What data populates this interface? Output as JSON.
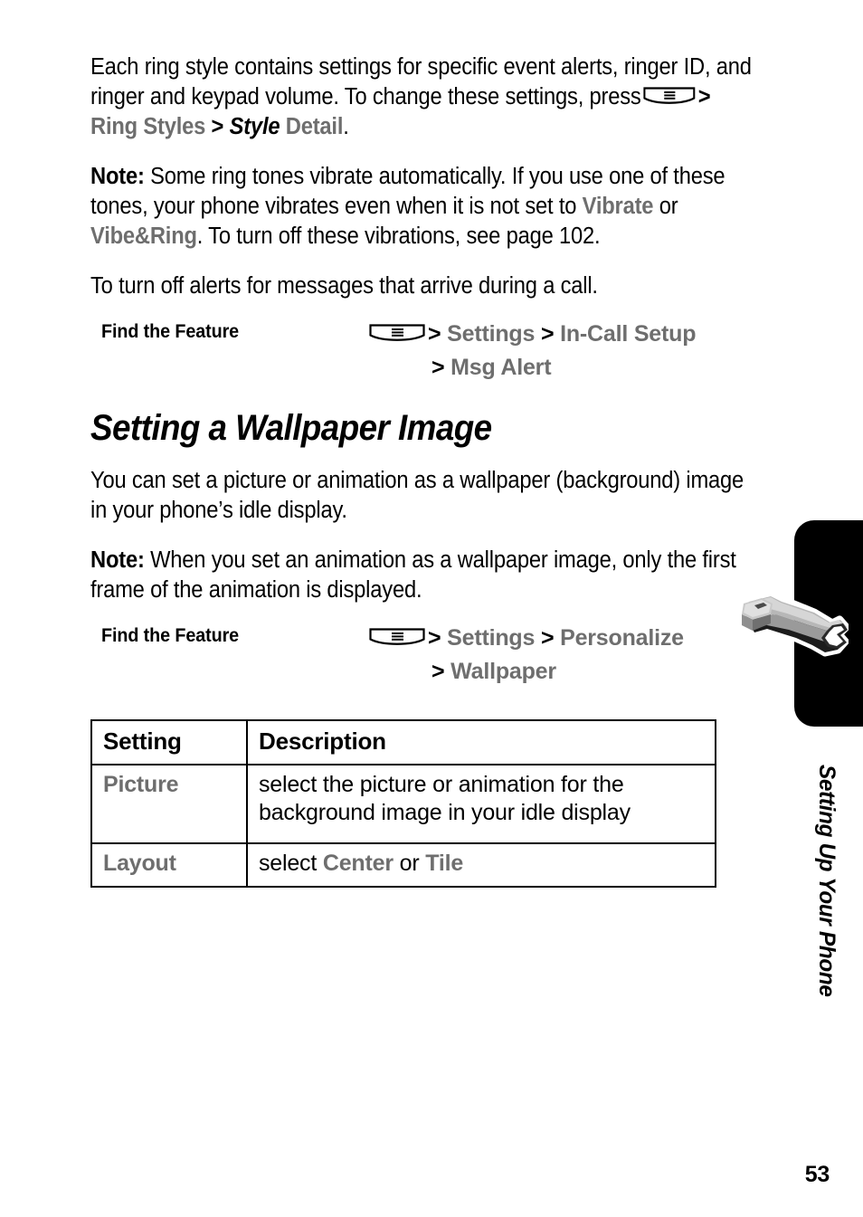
{
  "page": {
    "number": "53",
    "running_head": "Setting Up Your Phone",
    "tab_icon": "wrench-icon"
  },
  "paragraphs": {
    "intro_part1": "Each ring style contains settings for specific event alerts, ringer ID, and ringer and keypad volume. To change these settings, press",
    "intro_menu_icon": "menu-softkey-icon",
    "intro_sep1": ">",
    "intro_ring_styles": "Ring Styles",
    "intro_sep2": ">",
    "intro_style": "Style",
    "intro_detail": "Detail",
    "intro_period": ".",
    "note1_label": "Note:",
    "note1_part1": "Some ring tones vibrate automatically. If you use one of these tones, your phone vibrates even when it is not set to",
    "note1_vibrate": "Vibrate",
    "note1_or": "or",
    "note1_vibering": "Vibe&Ring",
    "note1_part2": ". To turn off these vibrations, see page 102.",
    "lead_in": "To turn off alerts for messages that arrive during a call.",
    "wallpaper_intro": "You can set a picture or animation as a wallpaper (background) image in your phone’s idle display.",
    "note2_label": "Note:",
    "note2_text": "When you set an animation as a wallpaper image, only the first frame of the animation is displayed."
  },
  "find_the_feature_1": {
    "label": "Find the Feature",
    "menu_icon": "menu-softkey-icon",
    "chevron1": ">",
    "item1": "Settings",
    "chevron2": ">",
    "item2": "In-Call Setup",
    "chevron3": ">",
    "item3": "Msg Alert"
  },
  "section_heading": "Setting a Wallpaper Image",
  "find_the_feature_2": {
    "label": "Find the Feature",
    "menu_icon": "menu-softkey-icon",
    "chevron1": ">",
    "item1": "Settings",
    "chevron2": ">",
    "item2": "Personalize",
    "chevron3": ">",
    "item3": "Wallpaper"
  },
  "table": {
    "headers": [
      "Setting",
      "Description"
    ],
    "rows": [
      {
        "setting": "Picture",
        "description": "select the picture or animation for the background image in your idle display"
      },
      {
        "setting": "Layout",
        "description_prefix": "select",
        "option1": "Center",
        "description_join": "or",
        "option2": "Tile"
      }
    ]
  },
  "colors": {
    "ui_gray": "#6e6e6e",
    "tab_black": "#000000",
    "text_black": "#000000"
  }
}
